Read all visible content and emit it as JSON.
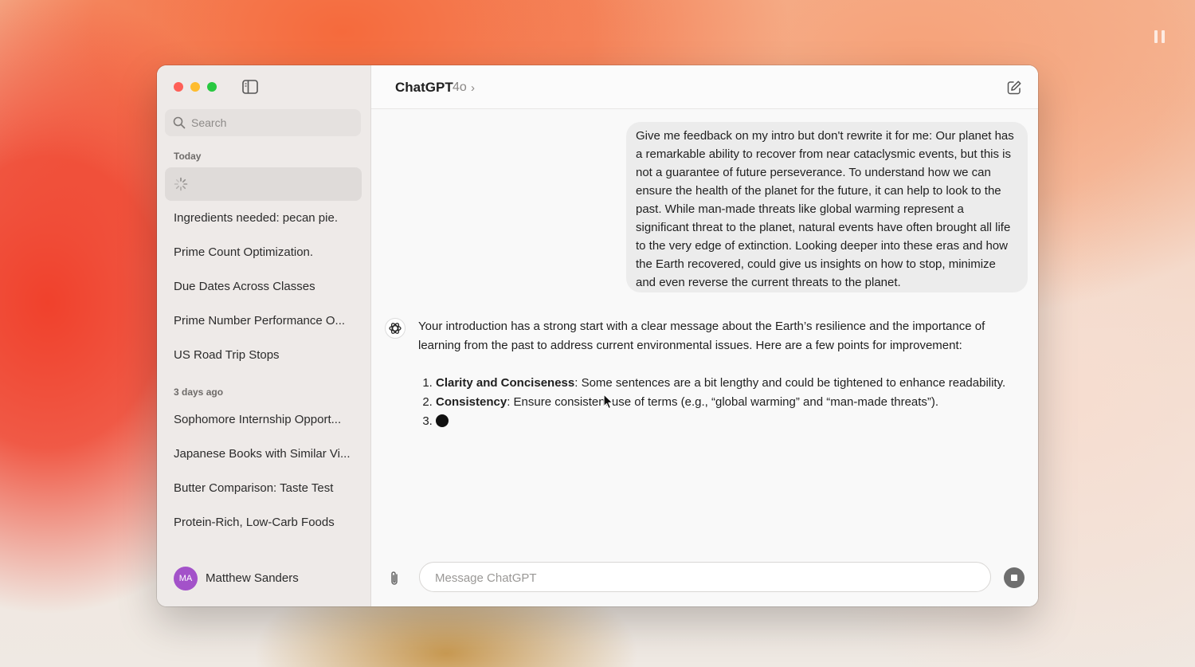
{
  "window": {
    "title": "ChatGPT",
    "model": "4o",
    "model_chevron": "›"
  },
  "sidebar": {
    "search_placeholder": "Search",
    "sections": [
      {
        "label": "Today",
        "items": [
          {
            "label": "",
            "loading": true
          },
          {
            "label": "Ingredients needed: pecan pie."
          },
          {
            "label": "Prime Count Optimization."
          },
          {
            "label": "Due Dates Across Classes"
          },
          {
            "label": "Prime Number Performance O..."
          },
          {
            "label": "US Road Trip Stops"
          }
        ]
      },
      {
        "label": "3 days ago",
        "items": [
          {
            "label": "Sophomore Internship Opport..."
          },
          {
            "label": "Japanese Books with Similar Vi..."
          },
          {
            "label": "Butter Comparison: Taste Test"
          },
          {
            "label": "Protein-Rich, Low-Carb Foods"
          }
        ]
      }
    ],
    "user": {
      "initials": "MA",
      "name": "Matthew Sanders",
      "avatar_color": "#a352c9"
    }
  },
  "conversation": {
    "user_message": "Give me feedback on my intro but don't rewrite it for me: Our planet has a remarkable ability to recover from near cataclysmic events, but this is not a guarantee of future perseverance. To understand how we can ensure the health of the planet for the future, it can help to look to the past. While man-made threats like global warming represent a significant threat to the planet, natural events have often brought all life to the very edge of extinction. Looking deeper into these eras and how the Earth recovered, could give us insights on how to stop, minimize and even reverse the current threats to the planet.",
    "assistant_intro": "Your introduction has a strong start with a clear message about the Earth’s resilience and the importance of learning from the past to address current environmental issues. Here are a few points for improvement:",
    "assistant_points": [
      {
        "title": "Clarity and Conciseness",
        "text": ": Some sentences are a bit lengthy and could be tightened to enhance readability."
      },
      {
        "title": "Consistency",
        "text": ": Ensure consistent use of terms (e.g., “global warming” and “man-made threats”)."
      },
      {
        "title": "",
        "text": "",
        "streaming": true
      }
    ]
  },
  "composer": {
    "placeholder": "Message ChatGPT"
  },
  "colors": {
    "close": "#fe5f57",
    "minimize": "#febc2e",
    "zoom": "#28c840",
    "stop_button": "#6e6e6e"
  }
}
